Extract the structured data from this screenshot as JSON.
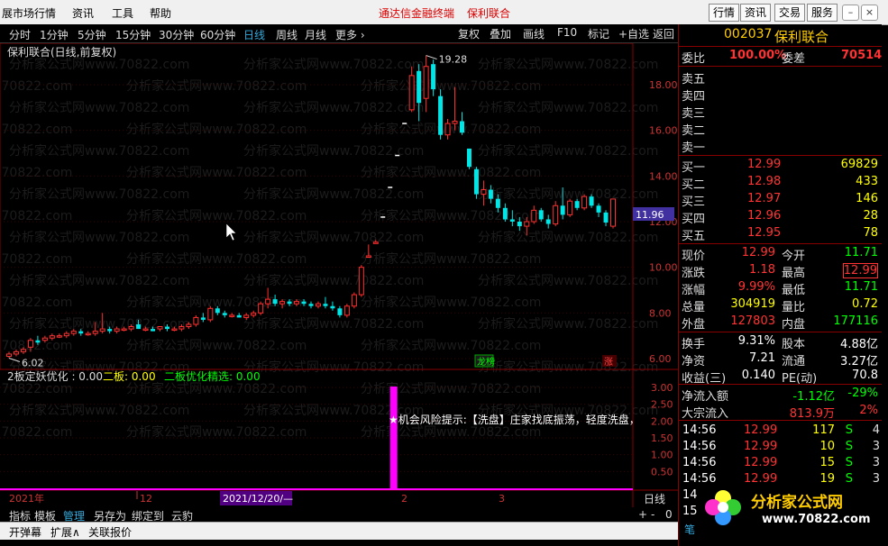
{
  "menu": {
    "items": [
      "展市场行情",
      "资讯",
      "工具",
      "帮助"
    ],
    "center_title": "通达信金融终端",
    "center_stock": "保利联合",
    "right_buttons": [
      "行情",
      "资讯",
      "交易",
      "服务"
    ]
  },
  "toolbar": {
    "periods": [
      "分时",
      "1分钟",
      "5分钟",
      "15分钟",
      "30分钟",
      "60分钟",
      "日线",
      "周线",
      "月线",
      "更多 ›"
    ],
    "active_period": "日线",
    "right_buttons": [
      "复权",
      "叠加",
      "画线",
      "F10",
      "标记",
      "+自选",
      "返回"
    ]
  },
  "chart": {
    "title": "保利联合(日线,前复权)",
    "high_label": "19.28",
    "low_label": "6.02",
    "current_price_tag": "11.96",
    "price_ticks": [
      "18.00",
      "16.00",
      "14.00",
      "12.00",
      "10.00",
      "8.00",
      "6.00"
    ],
    "indicator_ticks": [
      "3.00",
      "2.50",
      "2.00",
      "1.50",
      "1.00",
      "0.50"
    ],
    "badge_dragon": "龙榜",
    "badge_up": "涨",
    "indicator_line": "2板定妖优化 : 0.00",
    "indicator_a_label": "二板: 0.00",
    "indicator_b_label": "二板优化精选: 0.00",
    "risk_text": "★机会风险提示:【洗盘】庄家找底振荡，轻度洗盘，",
    "timeline_year": "2021年",
    "timeline_m12": "12",
    "timeline_date": "2021/12/20/—",
    "timeline_m2": "2",
    "timeline_m3": "3",
    "period_label": "日线",
    "watermark": "分析家公式网www.70822.com"
  },
  "chart_data": {
    "type": "candlestick",
    "ylim": [
      6,
      19.5
    ],
    "candles": [
      {
        "o": 6.1,
        "h": 6.3,
        "l": 6.02,
        "c": 6.2
      },
      {
        "o": 6.2,
        "h": 6.4,
        "l": 6.1,
        "c": 6.3
      },
      {
        "o": 6.3,
        "h": 6.5,
        "l": 6.2,
        "c": 6.4
      },
      {
        "o": 6.5,
        "h": 6.9,
        "l": 6.3,
        "c": 6.8
      },
      {
        "o": 6.8,
        "h": 7.0,
        "l": 6.6,
        "c": 6.7
      },
      {
        "o": 6.8,
        "h": 7.0,
        "l": 6.7,
        "c": 6.9
      },
      {
        "o": 6.9,
        "h": 7.1,
        "l": 6.8,
        "c": 7.0
      },
      {
        "o": 7.0,
        "h": 7.1,
        "l": 6.9,
        "c": 7.0
      },
      {
        "o": 7.0,
        "h": 7.2,
        "l": 6.9,
        "c": 7.1
      },
      {
        "o": 7.1,
        "h": 7.3,
        "l": 7.0,
        "c": 7.2
      },
      {
        "o": 7.2,
        "h": 7.3,
        "l": 7.0,
        "c": 7.1
      },
      {
        "o": 7.1,
        "h": 7.2,
        "l": 7.0,
        "c": 7.1
      },
      {
        "o": 7.1,
        "h": 7.6,
        "l": 7.0,
        "c": 7.2
      },
      {
        "o": 7.2,
        "h": 8.0,
        "l": 7.1,
        "c": 7.3
      },
      {
        "o": 7.3,
        "h": 7.4,
        "l": 7.1,
        "c": 7.2
      },
      {
        "o": 7.2,
        "h": 7.4,
        "l": 7.1,
        "c": 7.3
      },
      {
        "o": 7.3,
        "h": 7.4,
        "l": 7.2,
        "c": 7.3
      },
      {
        "o": 7.3,
        "h": 7.5,
        "l": 7.2,
        "c": 7.4
      },
      {
        "o": 7.5,
        "h": 7.7,
        "l": 7.3,
        "c": 7.3
      },
      {
        "o": 7.3,
        "h": 7.4,
        "l": 7.2,
        "c": 7.3
      },
      {
        "o": 7.3,
        "h": 7.4,
        "l": 7.2,
        "c": 7.2
      },
      {
        "o": 7.3,
        "h": 7.4,
        "l": 7.2,
        "c": 7.4
      },
      {
        "o": 7.4,
        "h": 7.5,
        "l": 7.2,
        "c": 7.3
      },
      {
        "o": 7.3,
        "h": 7.4,
        "l": 7.2,
        "c": 7.3
      },
      {
        "o": 7.3,
        "h": 7.5,
        "l": 7.2,
        "c": 7.4
      },
      {
        "o": 7.4,
        "h": 7.6,
        "l": 7.3,
        "c": 7.5
      },
      {
        "o": 7.5,
        "h": 7.9,
        "l": 7.4,
        "c": 7.8
      },
      {
        "o": 7.8,
        "h": 8.0,
        "l": 7.6,
        "c": 7.7
      },
      {
        "o": 7.7,
        "h": 8.3,
        "l": 7.6,
        "c": 8.2
      },
      {
        "o": 8.2,
        "h": 8.3,
        "l": 7.9,
        "c": 8.0
      },
      {
        "o": 8.0,
        "h": 8.1,
        "l": 7.8,
        "c": 7.9
      },
      {
        "o": 7.9,
        "h": 8.0,
        "l": 7.8,
        "c": 7.9
      },
      {
        "o": 7.9,
        "h": 8.0,
        "l": 7.8,
        "c": 7.8
      },
      {
        "o": 7.8,
        "h": 8.0,
        "l": 7.7,
        "c": 7.9
      },
      {
        "o": 7.9,
        "h": 8.1,
        "l": 7.8,
        "c": 8.0
      },
      {
        "o": 8.0,
        "h": 8.5,
        "l": 7.9,
        "c": 8.4
      },
      {
        "o": 8.4,
        "h": 9.1,
        "l": 8.2,
        "c": 8.6
      },
      {
        "o": 8.6,
        "h": 8.8,
        "l": 8.3,
        "c": 8.4
      },
      {
        "o": 8.4,
        "h": 8.6,
        "l": 8.2,
        "c": 8.5
      },
      {
        "o": 8.5,
        "h": 8.6,
        "l": 8.3,
        "c": 8.4
      },
      {
        "o": 8.4,
        "h": 8.6,
        "l": 8.3,
        "c": 8.5
      },
      {
        "o": 8.5,
        "h": 8.6,
        "l": 8.3,
        "c": 8.4
      },
      {
        "o": 8.4,
        "h": 8.5,
        "l": 8.2,
        "c": 8.3
      },
      {
        "o": 8.3,
        "h": 8.5,
        "l": 8.2,
        "c": 8.4
      },
      {
        "o": 8.4,
        "h": 8.7,
        "l": 8.2,
        "c": 8.3
      },
      {
        "o": 8.3,
        "h": 8.5,
        "l": 8.1,
        "c": 8.2
      },
      {
        "o": 8.2,
        "h": 8.3,
        "l": 7.8,
        "c": 7.9
      },
      {
        "o": 7.9,
        "h": 8.4,
        "l": 7.8,
        "c": 8.3
      },
      {
        "o": 8.3,
        "h": 8.9,
        "l": 8.2,
        "c": 8.8
      },
      {
        "o": 8.8,
        "h": 10.1,
        "l": 8.7,
        "c": 10.0
      },
      {
        "o": 10.5,
        "h": 11.0,
        "l": 10.5,
        "c": 10.5
      },
      {
        "o": 11.1,
        "h": 11.2,
        "l": 11.1,
        "c": 11.1
      },
      {
        "o": 12.2,
        "h": 12.2,
        "l": 12.2,
        "c": 12.2
      },
      {
        "o": 13.5,
        "h": 13.5,
        "l": 13.5,
        "c": 13.5
      },
      {
        "o": 14.9,
        "h": 14.9,
        "l": 14.9,
        "c": 14.9
      },
      {
        "o": 16.3,
        "h": 16.3,
        "l": 16.3,
        "c": 16.3
      },
      {
        "o": 16.9,
        "h": 18.8,
        "l": 16.8,
        "c": 18.4
      },
      {
        "o": 18.6,
        "h": 18.9,
        "l": 16.4,
        "c": 17.2
      },
      {
        "o": 17.4,
        "h": 19.28,
        "l": 16.8,
        "c": 18.8
      },
      {
        "o": 18.9,
        "h": 19.1,
        "l": 17.5,
        "c": 17.8
      },
      {
        "o": 17.5,
        "h": 17.8,
        "l": 15.6,
        "c": 15.8
      },
      {
        "o": 15.8,
        "h": 16.5,
        "l": 15.6,
        "c": 16.3
      },
      {
        "o": 16.3,
        "h": 17.9,
        "l": 16.0,
        "c": 16.4
      },
      {
        "o": 16.4,
        "h": 16.8,
        "l": 15.8,
        "c": 15.9
      },
      {
        "o": 15.2,
        "h": 15.2,
        "l": 14.3,
        "c": 14.4
      },
      {
        "o": 14.3,
        "h": 14.4,
        "l": 13.0,
        "c": 13.2
      },
      {
        "o": 13.2,
        "h": 13.8,
        "l": 12.7,
        "c": 13.4
      },
      {
        "o": 13.4,
        "h": 13.6,
        "l": 12.8,
        "c": 13.0
      },
      {
        "o": 13.0,
        "h": 13.2,
        "l": 12.4,
        "c": 12.6
      },
      {
        "o": 12.6,
        "h": 12.8,
        "l": 12.0,
        "c": 12.1
      },
      {
        "o": 12.1,
        "h": 12.5,
        "l": 11.8,
        "c": 12.0
      },
      {
        "o": 12.0,
        "h": 12.2,
        "l": 11.6,
        "c": 11.8
      },
      {
        "o": 11.8,
        "h": 12.2,
        "l": 11.4,
        "c": 12.0
      },
      {
        "o": 12.0,
        "h": 12.7,
        "l": 11.9,
        "c": 12.5
      },
      {
        "o": 12.5,
        "h": 12.6,
        "l": 12.0,
        "c": 12.1
      },
      {
        "o": 12.1,
        "h": 12.3,
        "l": 11.7,
        "c": 11.9
      },
      {
        "o": 11.9,
        "h": 12.9,
        "l": 11.8,
        "c": 12.7
      },
      {
        "o": 12.7,
        "h": 13.5,
        "l": 12.1,
        "c": 12.3
      },
      {
        "o": 12.3,
        "h": 13.0,
        "l": 12.2,
        "c": 12.9
      },
      {
        "o": 12.9,
        "h": 13.0,
        "l": 12.5,
        "c": 12.6
      },
      {
        "o": 12.6,
        "h": 13.2,
        "l": 12.5,
        "c": 13.1
      },
      {
        "o": 13.1,
        "h": 13.2,
        "l": 12.6,
        "c": 12.7
      },
      {
        "o": 12.7,
        "h": 12.8,
        "l": 12.2,
        "c": 12.4
      },
      {
        "o": 12.4,
        "h": 12.5,
        "l": 11.8,
        "c": 11.96
      },
      {
        "o": 11.8,
        "h": 13.0,
        "l": 11.7,
        "c": 12.99
      }
    ],
    "volume_spike": {
      "index": 53,
      "value": 3.0
    }
  },
  "panel": {
    "code": "002037",
    "name": "保利联合",
    "weibi_label": "委比",
    "weibi_value": "100.00%",
    "weicha_label": "委差",
    "weicha_value": "70514",
    "sells": [
      {
        "label": "卖五"
      },
      {
        "label": "卖四"
      },
      {
        "label": "卖三"
      },
      {
        "label": "卖二"
      },
      {
        "label": "卖一"
      }
    ],
    "buys": [
      {
        "label": "买一",
        "price": "12.99",
        "vol": "69829"
      },
      {
        "label": "买二",
        "price": "12.98",
        "vol": "433"
      },
      {
        "label": "买三",
        "price": "12.97",
        "vol": "146"
      },
      {
        "label": "买四",
        "price": "12.96",
        "vol": "28"
      },
      {
        "label": "买五",
        "price": "12.95",
        "vol": "78"
      }
    ],
    "stats": [
      {
        "l1": "现价",
        "v1": "12.99",
        "l2": "今开",
        "v2": "11.71"
      },
      {
        "l1": "涨跌",
        "v1": "1.18",
        "l2": "最高",
        "v2": "12.99"
      },
      {
        "l1": "涨幅",
        "v1": "9.99%",
        "l2": "最低",
        "v2": "11.71"
      },
      {
        "l1": "总量",
        "v1": "304919",
        "l2": "量比",
        "v2": "0.72"
      },
      {
        "l1": "外盘",
        "v1": "127803",
        "l2": "内盘",
        "v2": "177116"
      }
    ],
    "stats2": [
      {
        "l1": "换手",
        "v1": "9.31%",
        "l2": "股本",
        "v2": "4.88亿"
      },
      {
        "l1": "净资",
        "v1": "7.21",
        "l2": "流通",
        "v2": "3.27亿"
      },
      {
        "l1": "收益(三)",
        "v1": "0.140",
        "l2": "PE(动)",
        "v2": "70.8"
      }
    ],
    "flow": [
      {
        "label": "净流入额",
        "v1": "-1.12亿",
        "v2": "-29%"
      },
      {
        "label": "大宗流入",
        "v1": "813.9万",
        "v2": "2%"
      }
    ],
    "ticks": [
      {
        "t": "14:56",
        "p": "12.99",
        "v": "117",
        "s": "S",
        "n": "4"
      },
      {
        "t": "14:56",
        "p": "12.99",
        "v": "10",
        "s": "S",
        "n": "3"
      },
      {
        "t": "14:56",
        "p": "12.99",
        "v": "15",
        "s": "S",
        "n": "3"
      },
      {
        "t": "14:56",
        "p": "12.99",
        "v": "19",
        "s": "S",
        "n": "3"
      },
      {
        "t": "14",
        "p": "",
        "v": "",
        "s": "",
        "n": ""
      },
      {
        "t": "15",
        "p": "",
        "v": "",
        "s": "",
        "n": ""
      }
    ],
    "logo_text": "分析家公式网",
    "logo_url": "www.70822.com",
    "bottom_char": "笔"
  },
  "bottom": {
    "tabs1": [
      "指标",
      "模板",
      "管理",
      "另存为",
      "绑定到",
      "云豹"
    ],
    "tabs2": [
      "开弹幕",
      "扩展∧",
      "关联报价"
    ],
    "page_controls": [
      "+",
      "-",
      "0"
    ]
  },
  "colors": {
    "up": "#ff3030",
    "down": "#00e5e5",
    "accent": "#ffcc00",
    "magenta": "#ff00ff",
    "green": "#00ff00"
  }
}
